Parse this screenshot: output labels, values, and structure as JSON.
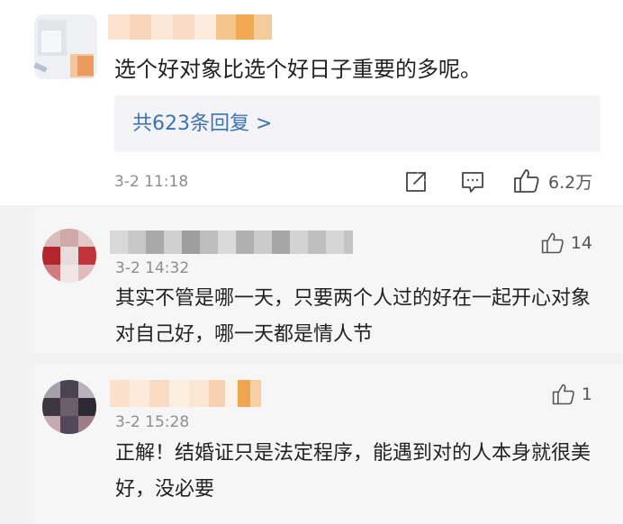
{
  "main_comment": {
    "text": "选个好对象比选个好日子重要的多呢。",
    "reply_link": "共623条回复 >",
    "time": "3-2 11:18",
    "like_count": "6.2万",
    "icons": [
      "share-icon",
      "comment-icon",
      "like-icon"
    ]
  },
  "replies": [
    {
      "time": "3-2 14:32",
      "text": "其实不管是哪一天，只要两个人过的好在一起开心对象对自己好，哪一天都是情人节",
      "like_count": "14"
    },
    {
      "time": "3-2 15:28",
      "text": "正解！结婚证只是法定程序，能遇到对的人本身就很美好，没必要",
      "like_count": "1"
    }
  ],
  "colors": {
    "link": "#3a72b7",
    "meta": "#8e8e8e",
    "reply_box_bg": "#f4f4f6",
    "sub_bg": "#f6f6f6"
  }
}
